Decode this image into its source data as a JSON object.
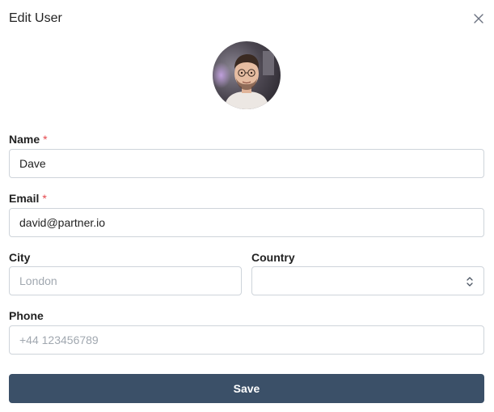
{
  "modal": {
    "title": "Edit User",
    "close_icon": "close-icon",
    "avatar_icon": "user-photo"
  },
  "form": {
    "name": {
      "label": "Name",
      "required_mark": "*",
      "value": "Dave"
    },
    "email": {
      "label": "Email",
      "required_mark": "*",
      "value": "david@partner.io"
    },
    "city": {
      "label": "City",
      "value": "",
      "placeholder": "London"
    },
    "country": {
      "label": "Country",
      "value": "",
      "icon": "chevron-up-down-icon"
    },
    "phone": {
      "label": "Phone",
      "value": "",
      "placeholder": "+44 123456789"
    }
  },
  "actions": {
    "save_label": "Save"
  },
  "colors": {
    "primary_button": "#3b5068",
    "required": "#e5484d",
    "input_border": "#ced4da",
    "placeholder": "#a1a8b0"
  }
}
